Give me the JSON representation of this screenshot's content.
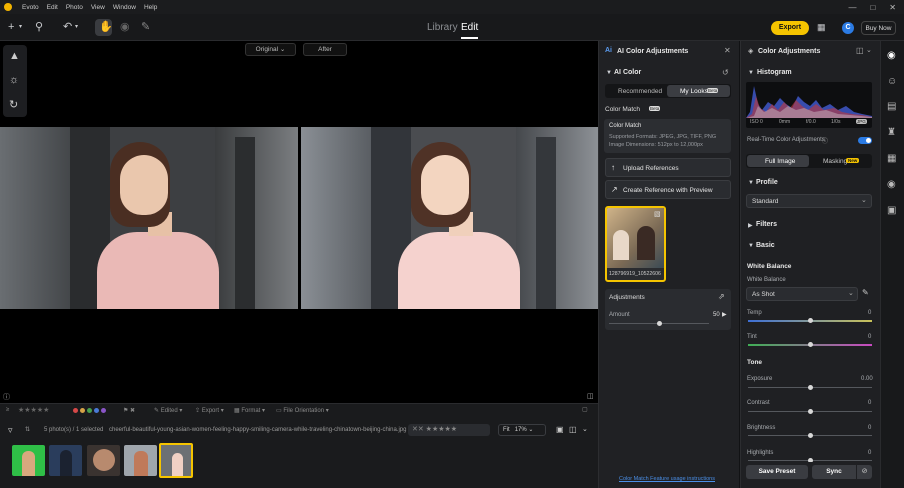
{
  "menubar": {
    "app": "Evoto",
    "items": [
      "Edit",
      "Photo",
      "View",
      "Window",
      "Help"
    ]
  },
  "toolbar": {
    "library": "Library",
    "edit": "Edit",
    "export": "Export",
    "buy": "Buy Now",
    "avatar": "C"
  },
  "canvas": {
    "original": "Original",
    "after": "After"
  },
  "filmbar": {
    "edited": "Edited",
    "export": "Export",
    "format": "Format",
    "orientation": "File Orientation"
  },
  "infobar": {
    "count": "5 photo(s) / 1 selected",
    "filename": "cheerful-beautiful-young-asian-women-feeling-happy-smiling-camera-while-traveling-chinatown-beijing-china.jpg",
    "fit": "Fit",
    "zoom": "17%"
  },
  "ai": {
    "title": "AI Color Adjustments",
    "section": "AI Color",
    "tab_recommended": "Recommended",
    "tab_mylooks": "My Looks",
    "beta": "Beta",
    "colormatch_label": "Color Match",
    "tooltip_title": "Color Match",
    "tooltip_line1": "Supported Formats: JPEG, JPG, TIFF, PNG",
    "tooltip_line2": "Image Dimensions: 512px to 12,000px",
    "upload": "Upload References",
    "create": "Create Reference with Preview",
    "ref_name": "128796919_10522606",
    "adjustments": "Adjustments",
    "amount_label": "Amount",
    "amount_value": "50",
    "amount_fraction": 0.5,
    "footer_link": "Color Match Feature usage instructions"
  },
  "adj": {
    "title": "Color Adjustments",
    "histogram": "Histogram",
    "hist_info": [
      "ISO 0",
      "0mm",
      "f/0.0",
      "1/0s"
    ],
    "hist_badge": "JPG",
    "realtime": "Real-Time Color Adjustments",
    "full_image": "Full Image",
    "masking": "Masking",
    "new_badge": "New",
    "profile": "Profile",
    "profile_value": "Standard",
    "filters": "Filters",
    "basic": "Basic",
    "white_balance": "White Balance",
    "wb_label": "White Balance",
    "wb_value": "As Shot",
    "temp": "Temp",
    "temp_value": "0",
    "temp_fraction": 0.5,
    "tint": "Tint",
    "tint_value": "0",
    "tint_fraction": 0.5,
    "tone": "Tone",
    "exposure": "Exposure",
    "exposure_value": "0.00",
    "exposure_fraction": 0.5,
    "contrast": "Contrast",
    "contrast_value": "0",
    "contrast_fraction": 0.5,
    "brightness": "Brightness",
    "brightness_value": "0",
    "brightness_fraction": 0.5,
    "highlights": "Highlights",
    "highlights_value": "0",
    "highlights_fraction": 0.5,
    "save_preset": "Save Preset",
    "sync": "Sync"
  },
  "colors": {
    "accent": "#f5c400",
    "blue": "#2b7be4",
    "link": "#4a8fe7"
  }
}
